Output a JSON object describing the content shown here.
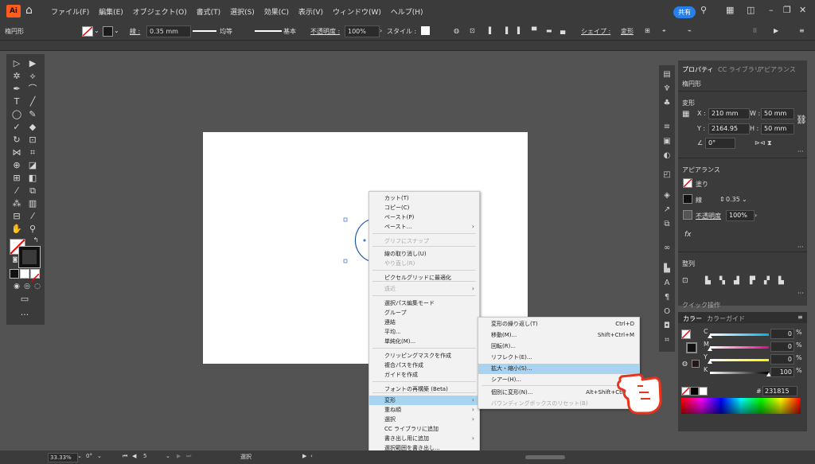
{
  "menubar": {
    "logo": "Ai",
    "items": [
      "ファイル(F)",
      "編集(E)",
      "オブジェクト(O)",
      "書式(T)",
      "選択(S)",
      "効果(C)",
      "表示(V)",
      "ウィンドウ(W)",
      "ヘルプ(H)"
    ],
    "share": "共有"
  },
  "control_bar": {
    "selection": "楕円形",
    "stroke_label": "線 :",
    "stroke_value": "0.35 mm",
    "profile": "均等",
    "brush": "基本",
    "opacity_label": "不透明度 :",
    "opacity_value": "100%",
    "style_label": "スタイル :",
    "shape_label": "シェイプ :",
    "transform_label": "変形"
  },
  "properties_panel": {
    "tabs": [
      "プロパティ",
      "CC ライブラリ",
      "アピアランス"
    ],
    "object_type": "楕円形",
    "transform_title": "変形",
    "x_label": "X :",
    "x_value": "210 mm",
    "y_label": "Y :",
    "y_value": "2164.95",
    "w_label": "W :",
    "w_value": "50 mm",
    "h_label": "H :",
    "h_value": "50 mm",
    "angle_value": "0°",
    "appearance_title": "アピアランス",
    "fill_label": "塗り",
    "stroke_label": "線",
    "stroke_value": "0.35",
    "opacity_label": "不透明度",
    "opacity_value": "100%",
    "fx_label": "fx",
    "align_title": "整列",
    "quick_actions_title": "クイック操作"
  },
  "color_panel": {
    "tabs": [
      "カラー",
      "カラーガイド"
    ],
    "channels": [
      {
        "label": "C",
        "value": "0",
        "unit": "%",
        "color": "#00aeef"
      },
      {
        "label": "M",
        "value": "0",
        "unit": "%",
        "color": "#ec008c"
      },
      {
        "label": "Y",
        "value": "0",
        "unit": "%",
        "color": "#fff200"
      },
      {
        "label": "K",
        "value": "100",
        "unit": "%",
        "color": "#000000"
      }
    ],
    "hex_prefix": "#",
    "hex_value": "231815"
  },
  "context_menu": {
    "items": [
      {
        "label": "カット(T)",
        "disabled": false,
        "submenu": false
      },
      {
        "label": "コピー(C)",
        "disabled": false,
        "submenu": false
      },
      {
        "label": "ペースト(P)",
        "disabled": false,
        "submenu": false
      },
      {
        "label": "ペースト...",
        "disabled": false,
        "submenu": true
      },
      {
        "label": "グリフにスナップ",
        "disabled": true,
        "submenu": false
      },
      {
        "label": "線の取り消し(U)",
        "disabled": false,
        "submenu": false
      },
      {
        "label": "やり直し(R)",
        "disabled": true,
        "submenu": false
      },
      {
        "label": "ピクセルグリッドに最適化",
        "disabled": false,
        "submenu": false
      },
      {
        "label": "遠近",
        "disabled": true,
        "submenu": true
      },
      {
        "label": "選択パス編集モード",
        "disabled": false,
        "submenu": false
      },
      {
        "label": "グループ",
        "disabled": false,
        "submenu": false
      },
      {
        "label": "連結",
        "disabled": false,
        "submenu": false
      },
      {
        "label": "平均...",
        "disabled": false,
        "submenu": false
      },
      {
        "label": "単純化(M)...",
        "disabled": false,
        "submenu": false
      },
      {
        "label": "クリッピングマスクを作成",
        "disabled": false,
        "submenu": false
      },
      {
        "label": "複合パスを作成",
        "disabled": false,
        "submenu": false
      },
      {
        "label": "ガイドを作成",
        "disabled": false,
        "submenu": false
      },
      {
        "label": "フォントの再構築 (Beta)",
        "disabled": false,
        "submenu": false
      },
      {
        "label": "変形",
        "disabled": false,
        "submenu": true,
        "highlighted": true
      },
      {
        "label": "重ね順",
        "disabled": false,
        "submenu": true
      },
      {
        "label": "選択",
        "disabled": false,
        "submenu": true
      },
      {
        "label": "CC ライブラリに追加",
        "disabled": false,
        "submenu": false
      },
      {
        "label": "書き出し用に追加",
        "disabled": false,
        "submenu": true
      },
      {
        "label": "選択範囲を書き出し...",
        "disabled": false,
        "submenu": false
      }
    ]
  },
  "transform_submenu": {
    "items": [
      {
        "label": "変形の繰り返し(T)",
        "shortcut": "Ctrl+D"
      },
      {
        "label": "移動(M)...",
        "shortcut": "Shift+Ctrl+M"
      },
      {
        "label": "回転(R)...",
        "shortcut": ""
      },
      {
        "label": "リフレクト(E)...",
        "shortcut": ""
      },
      {
        "label": "拡大・縮小(S)...",
        "shortcut": "",
        "highlighted": true
      },
      {
        "label": "シアー(H)...",
        "shortcut": ""
      },
      {
        "label": "個別に変形(N)...",
        "shortcut": "Alt+Shift+Ctrl+D"
      },
      {
        "label": "バウンディングボックスのリセット(B)",
        "shortcut": "",
        "disabled": true
      }
    ]
  },
  "status_bar": {
    "zoom": "33.33%",
    "rotation": "0°",
    "artboard": "5",
    "tool": "選択"
  },
  "colors": {
    "ui_dark": "#3b3b3b",
    "canvas": "#535353",
    "highlight": "#a8d4f2",
    "accent_blue": "#2680eb",
    "hand_red": "#e8341c"
  }
}
